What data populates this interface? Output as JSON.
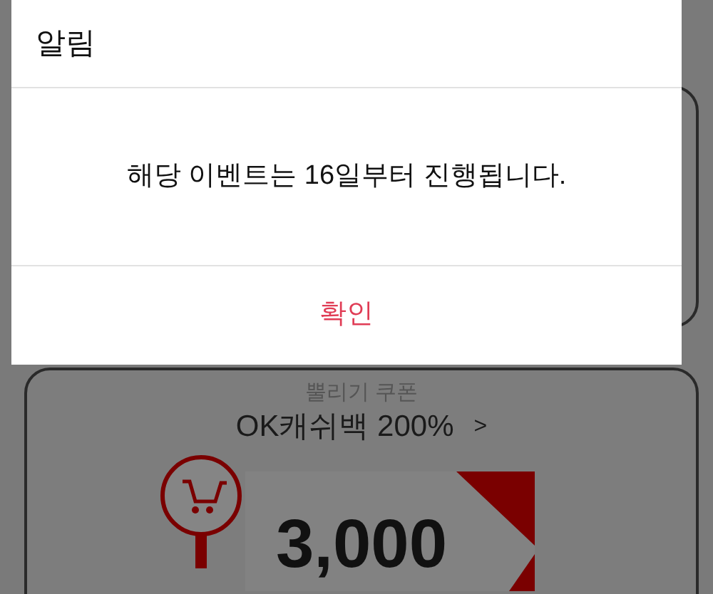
{
  "dialog": {
    "title": "알림",
    "message": "해당 이벤트는 16일부터 진행됩니다.",
    "confirm_button": "확인"
  },
  "coupon_card": {
    "subtitle": "뿔리기 쿠폰",
    "title": "OK캐쉬백 200%",
    "link_arrow": ">",
    "amount": "3,000"
  }
}
